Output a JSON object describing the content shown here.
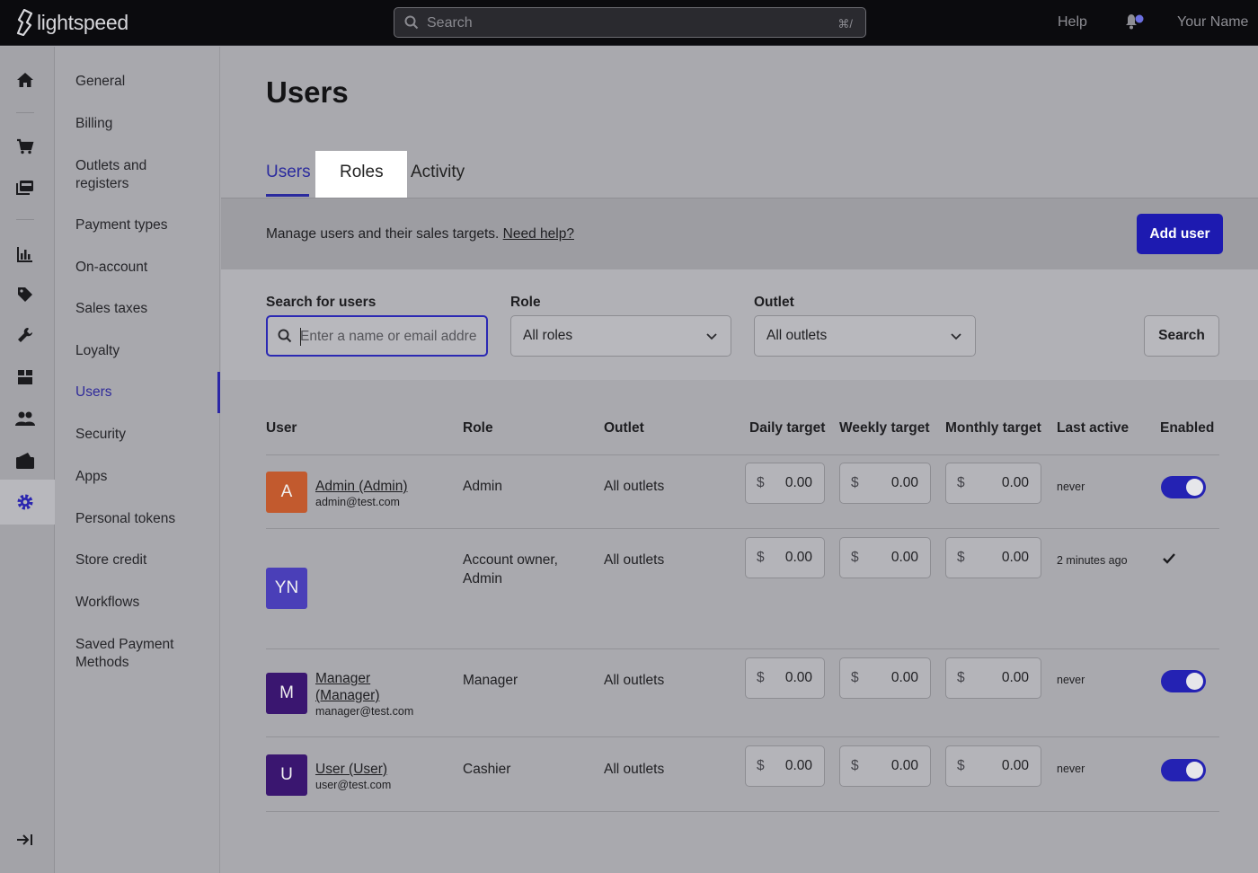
{
  "app": {
    "logo_text": "lightspeed",
    "search_placeholder": "Search",
    "search_shortcut": "⌘/",
    "help_label": "Help",
    "user_name": "Your Name"
  },
  "rail_icons": [
    "home-icon",
    "cart-icon",
    "catalog-icon",
    "reports-icon",
    "tag-icon",
    "wrench-icon",
    "inventory-icon",
    "customers-icon",
    "wallet-icon",
    "settings-icon",
    "collapse-icon"
  ],
  "subnav": {
    "items": [
      {
        "label": "General"
      },
      {
        "label": "Billing"
      },
      {
        "label": "Outlets and registers"
      },
      {
        "label": "Payment types"
      },
      {
        "label": "On-account"
      },
      {
        "label": "Sales taxes"
      },
      {
        "label": "Loyalty"
      },
      {
        "label": "Users",
        "active": true
      },
      {
        "label": "Security"
      },
      {
        "label": "Apps"
      },
      {
        "label": "Personal tokens"
      },
      {
        "label": "Store credit"
      },
      {
        "label": "Workflows"
      },
      {
        "label": "Saved Payment Methods"
      }
    ]
  },
  "page": {
    "title": "Users",
    "tabs": [
      {
        "label": "Users",
        "active": true
      },
      {
        "label": "Roles"
      },
      {
        "label": "Activity"
      }
    ],
    "info_text": "Manage users and their sales targets.",
    "help_link": "Need help?",
    "add_user_label": "Add user"
  },
  "filters": {
    "search_label": "Search for users",
    "search_placeholder": "Enter a name or email address",
    "role_label": "Role",
    "role_value": "All roles",
    "outlet_label": "Outlet",
    "outlet_value": "All outlets",
    "search_button": "Search"
  },
  "table": {
    "headers": [
      "User",
      "Role",
      "Outlet",
      "Daily target",
      "Weekly target",
      "Monthly target",
      "Last active",
      "Enabled"
    ],
    "currency": "$",
    "rows": [
      {
        "initials": "A",
        "avatar_color": "#c25a2e",
        "name": "Admin (Admin)",
        "email": "admin@test.com",
        "role": "Admin",
        "outlet": "All outlets",
        "daily": "0.00",
        "weekly": "0.00",
        "monthly": "0.00",
        "last_active": "never",
        "enabled": true
      },
      {
        "initials": "YN",
        "avatar_color": "#4a3fb8",
        "name": "",
        "email": "",
        "role": "Account owner, Admin",
        "outlet": "All outlets",
        "daily": "0.00",
        "weekly": "0.00",
        "monthly": "0.00",
        "last_active": "2 minutes ago",
        "enabled": "check"
      },
      {
        "initials": "M",
        "avatar_color": "#3a1670",
        "name": "Manager (Manager)",
        "email": "manager@test.com",
        "role": "Manager",
        "outlet": "All outlets",
        "daily": "0.00",
        "weekly": "0.00",
        "monthly": "0.00",
        "last_active": "never",
        "enabled": true
      },
      {
        "initials": "U",
        "avatar_color": "#3a1670",
        "name": "User (User)",
        "email": "user@test.com",
        "role": "Cashier",
        "outlet": "All outlets",
        "daily": "0.00",
        "weekly": "0.00",
        "monthly": "0.00",
        "last_active": "never",
        "enabled": true
      }
    ]
  }
}
